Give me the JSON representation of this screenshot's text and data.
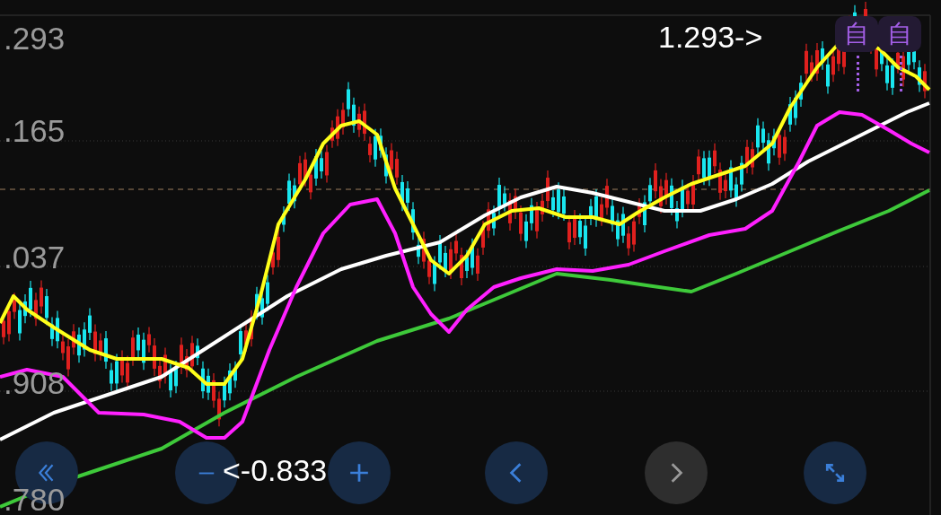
{
  "y_axis_labels": [
    ".293",
    ".165",
    ".037",
    ".908",
    ".780"
  ],
  "high_marker": "1.293->",
  "low_marker": "<-0.833",
  "badges": [
    {
      "label": "自"
    },
    {
      "label": "自"
    }
  ],
  "buttons": [
    {
      "kind": "rewind",
      "disabled": false
    },
    {
      "kind": "zoom_out",
      "disabled": false
    },
    {
      "kind": "zoom_in",
      "disabled": false
    },
    {
      "kind": "previous",
      "disabled": false
    },
    {
      "kind": "next",
      "disabled": true
    },
    {
      "kind": "fullscreen",
      "disabled": false
    }
  ]
}
